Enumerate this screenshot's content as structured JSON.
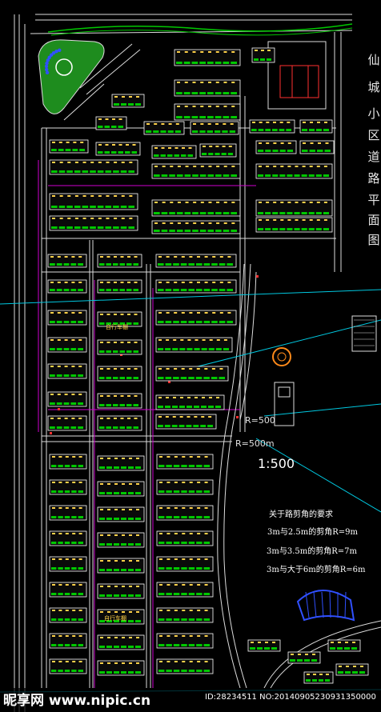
{
  "title_chars": [
    "仙",
    "城",
    "小",
    "区",
    "道",
    "路",
    "平",
    "面",
    "图"
  ],
  "scale_label": "1:500",
  "radius_labels": {
    "upper": "R=500",
    "lower": "R=500m"
  },
  "notes": {
    "heading": "关于路剪角的要求",
    "lines": [
      "3m与2.5m的剪角R=9m",
      "3m与3.5m的剪角R=7m",
      "3m与大于6m的剪角R=6m"
    ]
  },
  "building_labels": {
    "center_upper": "自行车棚",
    "lower_left": "自行车棚"
  },
  "watermark": {
    "logo": "昵享网 www.nipic.cn",
    "id": "ID:28234511 NO:20140905230931350000"
  },
  "colors": {
    "background": "#000000",
    "road_white": "#dcdcdc",
    "building_outline": "#ffffff",
    "building_fill": "#0a0a0a",
    "green_belt": "#00c800",
    "park": "#1e8c1e",
    "magenta_line": "#d000d0",
    "cyan_line": "#00c8e0",
    "blue_line": "#3050ff",
    "yellow_label": "#ffd24a",
    "red_line": "#ff3030"
  }
}
